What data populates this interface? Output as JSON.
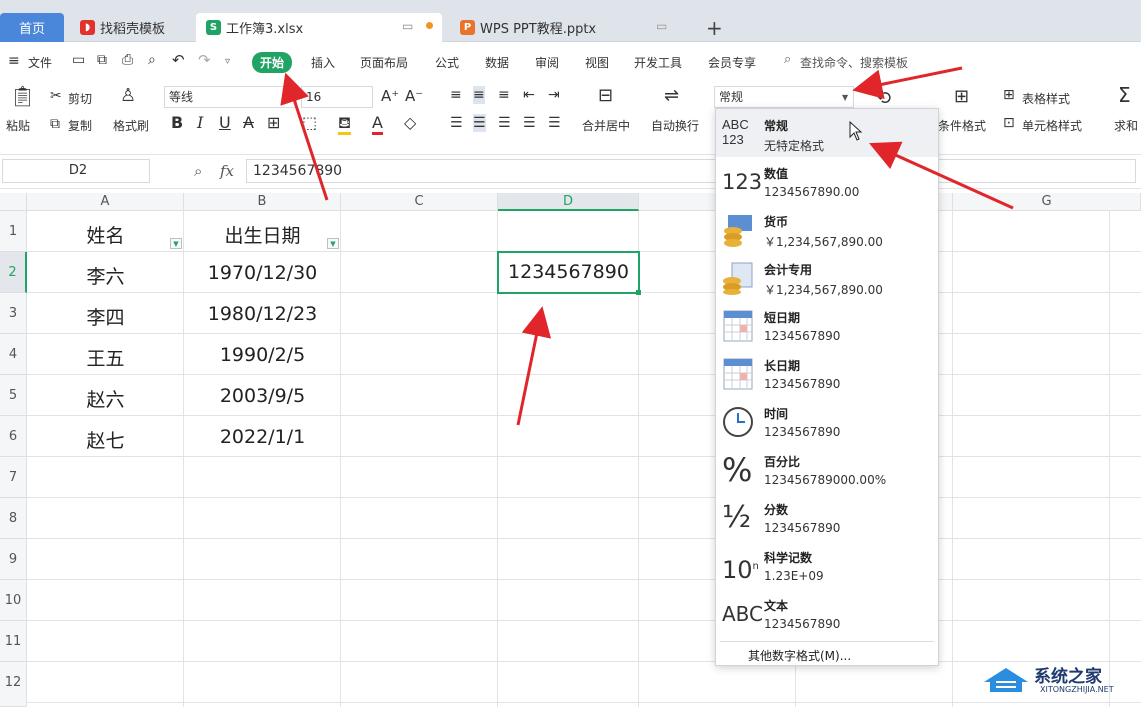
{
  "tabs": {
    "home": "首页",
    "template": "找稻壳模板",
    "workbook": "工作簿3.xlsx",
    "ppt": "WPS PPT教程.pptx",
    "add": "+"
  },
  "menu": {
    "file": "文件",
    "start": "开始",
    "insert": "插入",
    "page_layout": "页面布局",
    "formula": "公式",
    "data": "数据",
    "review": "审阅",
    "view": "视图",
    "dev_tools": "开发工具",
    "member": "会员专享",
    "search": "查找命令、搜索模板"
  },
  "ribbon": {
    "paste": "粘贴",
    "cut": "剪切",
    "copy": "复制",
    "format_painter": "格式刷",
    "font_name": "等线",
    "font_size": "16",
    "merge_center": "合并居中",
    "wrap_text": "自动换行",
    "number_format": "常规",
    "cond_format": "条件格式",
    "table_style": "表格样式",
    "cell_style": "单元格样式",
    "sum": "求和"
  },
  "formula_bar": {
    "cell_ref": "D2",
    "fx": "fx",
    "value": "1234567890"
  },
  "columns": [
    "A",
    "B",
    "C",
    "D",
    "G"
  ],
  "rows": [
    "1",
    "2",
    "3",
    "4",
    "5",
    "6",
    "7",
    "8",
    "9",
    "10",
    "11",
    "12"
  ],
  "table": {
    "header_name": "姓名",
    "header_dob": "出生日期",
    "names": [
      "李六",
      "李四",
      "王五",
      "赵六",
      "赵七"
    ],
    "dates": [
      "1970/12/30",
      "1980/12/23",
      "1990/2/5",
      "2003/9/5",
      "2022/1/1"
    ],
    "d2": "1234567890"
  },
  "dropdown": {
    "items": [
      {
        "name": "常规",
        "value": "无特定格式",
        "icon": "abc-123-icon"
      },
      {
        "name": "数值",
        "value": "1234567890.00",
        "icon": "number-123-icon"
      },
      {
        "name": "货币",
        "value": "￥1,234,567,890.00",
        "icon": "currency-coins-icon"
      },
      {
        "name": "会计专用",
        "value": "￥1,234,567,890.00",
        "icon": "accounting-icon"
      },
      {
        "name": "短日期",
        "value": "1234567890",
        "icon": "calendar-icon"
      },
      {
        "name": "长日期",
        "value": "1234567890",
        "icon": "calendar-icon"
      },
      {
        "name": "时间",
        "value": "1234567890",
        "icon": "clock-icon"
      },
      {
        "name": "百分比",
        "value": "123456789000.00%",
        "icon": "percent-icon"
      },
      {
        "name": "分数",
        "value": "1234567890",
        "icon": "fraction-icon"
      },
      {
        "name": "科学记数",
        "value": "1.23E+09",
        "icon": "scientific-icon"
      },
      {
        "name": "文本",
        "value": "1234567890",
        "icon": "abc-text-icon"
      }
    ],
    "more": "其他数字格式(M)..."
  },
  "watermark": {
    "name": "系统之家",
    "url": "XITONGZHIJIA.NET"
  },
  "colors": {
    "accent_green": "#21a366",
    "arrow_red": "#e0262a",
    "tab_blue": "#4a86d9"
  }
}
